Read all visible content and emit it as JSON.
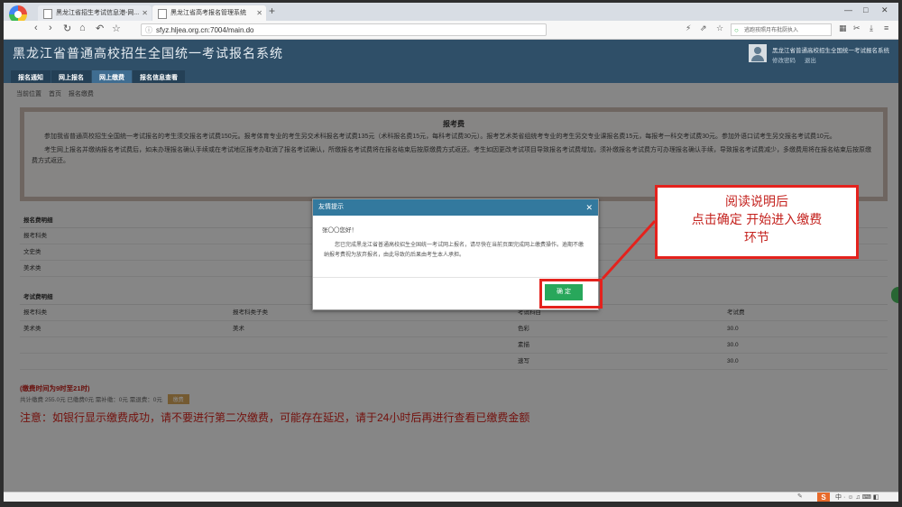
{
  "browser": {
    "tabs": [
      {
        "title": "黑龙江省招生考试信息港-网..."
      },
      {
        "title": "黑龙江省高考报名管理系统"
      }
    ],
    "url": "sfyz.hljea.org.cn:7004/main.do",
    "search_placeholder": "逃跑孩照月布批厨执入",
    "new_tab": "+",
    "window_controls": [
      "—",
      "□",
      "✕"
    ]
  },
  "header": {
    "title": "黑龙江省普通高校招生全国统一考试报名系统",
    "user": "黑龙江省普通高校招生全国统一考试报名系统",
    "links": [
      "修改密码",
      "退出"
    ],
    "nav": [
      {
        "label": "报名通知",
        "active": false
      },
      {
        "label": "网上报名",
        "active": false
      },
      {
        "label": "网上缴费",
        "active": true
      },
      {
        "label": "报名信息查看",
        "active": false
      }
    ]
  },
  "breadcrumb": [
    "当前位置",
    "首页",
    "报名缴费"
  ],
  "notice": {
    "title": "报考费",
    "p1": "参加我省普通高校招生全国统一考试报名的考生须交报名考试费150元。报考体育专业的考生另交术科报名考试费135元（术科报名费15元，每科考试费30元）。报考艺术类省组统考专业的考生另交专业课报名费15元，每报考一科交考试费30元。参加外语口试考生另交报名考试费10元。",
    "p2": "考生网上报名并缴纳报名考试费后，如未办理报名确认手续或在考试地区报考办取消了报名考试确认，所缴报名考试费将在报名结束后按原缴费方式返还。考生如因更改考试项目导致报名考试费增加，须补缴报名考试费方可办理报名确认手续，导致报名考试费减少，多缴费用将在报名结束后按原缴费方式返还。"
  },
  "section1": {
    "head": "报名费明细",
    "rows": [
      "报考科类",
      "文史类",
      "美术类"
    ]
  },
  "section2": {
    "head": "考试费明细",
    "columns": [
      "报考科类",
      "报考科类子类",
      "考试科目",
      "考试费"
    ],
    "rows": [
      [
        "美术类",
        "美术",
        "色彩",
        "30.0"
      ],
      [
        "",
        "",
        "素描",
        "30.0"
      ],
      [
        "",
        "",
        "速写",
        "30.0"
      ]
    ]
  },
  "pay": {
    "hours": "(缴费时间为9时至21时)",
    "summary": "共计缴费 255.0元 已缴费0元 需补缴：0元 需退费：0元",
    "button": "缴费"
  },
  "warning": "注意：如银行显示缴费成功，请不要进行第二次缴费，可能存在延迟，请于24小时后再进行查看已缴费金额",
  "modal": {
    "title": "友情提示",
    "close": "✕",
    "greeting": "张〇〇您好！",
    "message": "您已完成黑龙江省普通高校招生全国统一考试网上报名，请尽快在当前页面完成网上缴费操作。逾期不缴纳报考费视为放弃报名，由此导致的后果由考生本人承担。",
    "ok": "确 定"
  },
  "callout": {
    "lines": [
      "阅读说明后",
      "点击确定 开始进入缴费",
      "环节"
    ]
  },
  "colors": {
    "header_bg": "#2f4f68",
    "active_tab": "#3f6d91",
    "modal_head": "#33799e",
    "ok_button": "#28a75b",
    "annotation_red": "#e4221d",
    "warning_red": "#d2211b"
  }
}
